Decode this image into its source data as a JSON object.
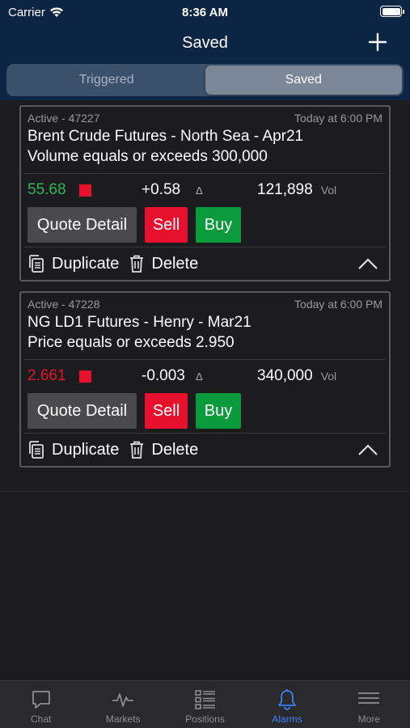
{
  "status": {
    "carrier": "Carrier",
    "time": "8:36 AM"
  },
  "navbar": {
    "title": "Saved"
  },
  "segments": [
    {
      "label": "Triggered",
      "active": false
    },
    {
      "label": "Saved",
      "active": true
    }
  ],
  "alerts": [
    {
      "status": "Active - 47227",
      "time": "Today at 6:00 PM",
      "name": "Brent Crude Futures - North Sea - Apr21",
      "condition": "Volume equals or exceeds 300,000",
      "price": "55.68",
      "price_color": "#2fb45a",
      "indicator_color": "#e8112d",
      "change": "+0.58",
      "delta_symbol": "Δ",
      "volume": "121,898",
      "vol_label": "Vol",
      "quote_detail": "Quote Detail",
      "sell": "Sell",
      "buy": "Buy",
      "duplicate": "Duplicate",
      "delete": "Delete"
    },
    {
      "status": "Active - 47228",
      "time": "Today at 6:00 PM",
      "name": "NG LD1 Futures - Henry - Mar21",
      "condition": "Price equals or exceeds 2.950",
      "price": "2.661",
      "price_color": "#e8112d",
      "indicator_color": "#e8112d",
      "change": "-0.003",
      "delta_symbol": "Δ",
      "volume": "340,000",
      "vol_label": "Vol",
      "quote_detail": "Quote Detail",
      "sell": "Sell",
      "buy": "Buy",
      "duplicate": "Duplicate",
      "delete": "Delete"
    }
  ],
  "tabbar": [
    {
      "label": "Chat",
      "icon": "chat-icon",
      "active": false
    },
    {
      "label": "Markets",
      "icon": "markets-icon",
      "active": false
    },
    {
      "label": "Positions",
      "icon": "positions-icon",
      "active": false
    },
    {
      "label": "Alarms",
      "icon": "bell-icon",
      "active": true
    },
    {
      "label": "More",
      "icon": "menu-icon",
      "active": false
    }
  ],
  "colors": {
    "header_bg": "#0d2545",
    "accent": "#3b82f6",
    "sell": "#e8112d",
    "buy": "#089a3b"
  }
}
